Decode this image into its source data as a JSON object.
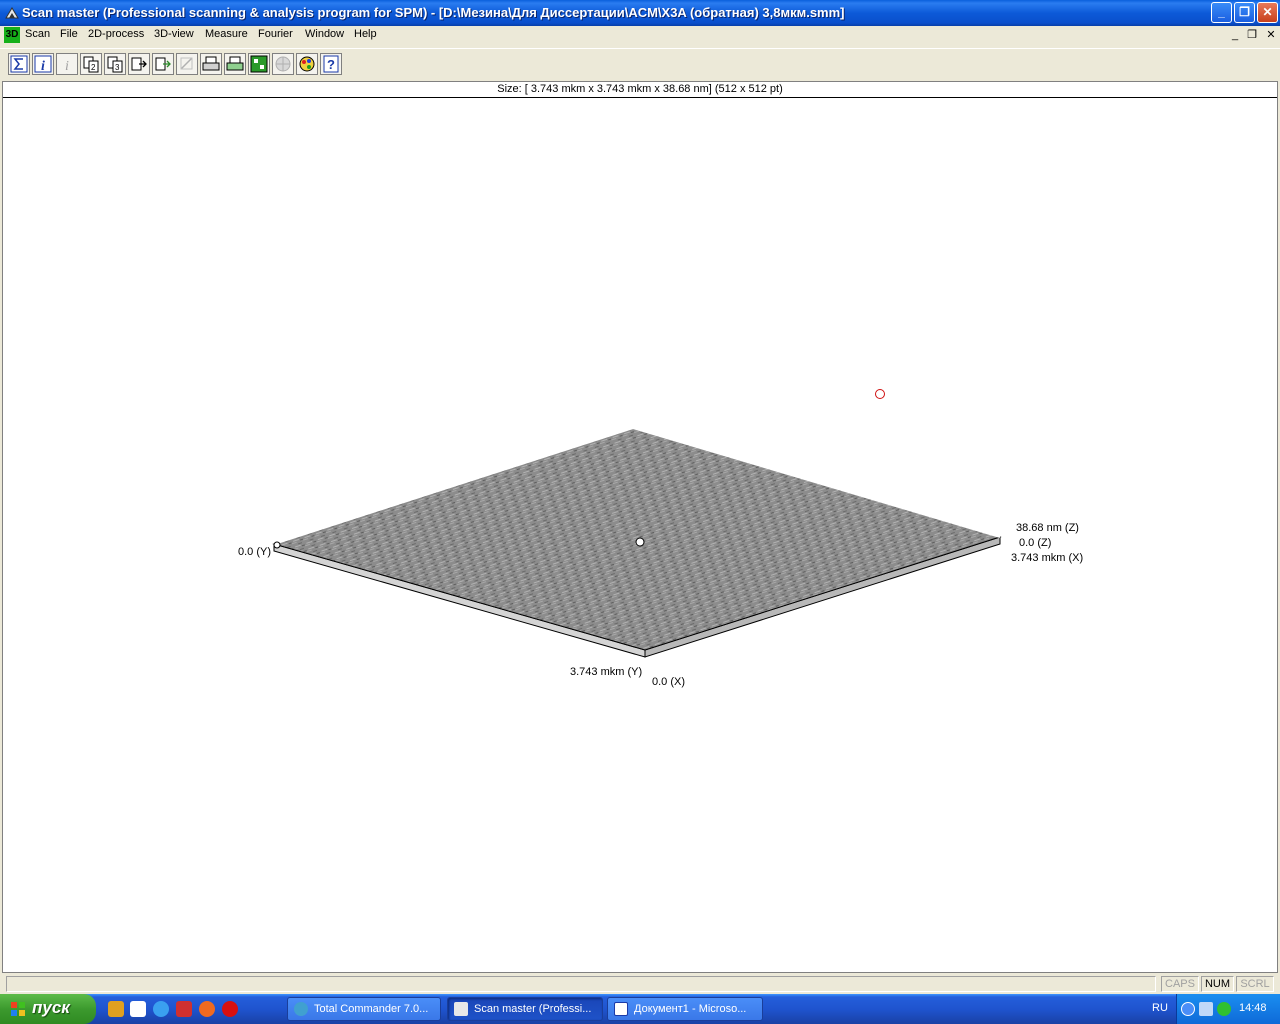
{
  "window": {
    "title": "Scan master (Professional scanning & analysis program for SPM) - [D:\\Мезина\\Для Диссертации\\ACM\\X3A (обратная) 3,8мкм.smm]",
    "minimize_label": "_",
    "maximize_label": "❐",
    "close_label": "✕"
  },
  "menu": {
    "doc_icon_text": "3D",
    "items": [
      "Scan",
      "File",
      "2D-process",
      "3D-view",
      "Measure",
      "Fourier",
      "Window",
      "Help"
    ],
    "mdi_minimize": "_",
    "mdi_restore": "❐",
    "mdi_close": "✕"
  },
  "toolbar": {
    "tools": [
      "sigma-icon",
      "info-icon",
      "info-disabled-icon",
      "copy-2-icon",
      "copy-3-icon",
      "export-1-icon",
      "export-2-icon",
      "disabled-tool-icon",
      "print-icon",
      "print-setup-icon",
      "stats-icon",
      "disabled-globe-icon",
      "palette-icon",
      "help-icon"
    ]
  },
  "document": {
    "size_info": "Size: [ 3.743 mkm x  3.743 mkm x  38.68 nm] (512 x 512 pt)",
    "axis_labels": {
      "y_origin": "0.0 (Y)",
      "y_max": "3.743 mkm (Y)",
      "x_origin": "0.0 (X)",
      "z_max": "38.68 nm (Z)",
      "z_origin": "0.0 (Z)",
      "x_max": "3.743 mkm (X)"
    }
  },
  "statusbar": {
    "caps": "CAPS",
    "num": "NUM",
    "scrl": "SCRL"
  },
  "taskbar": {
    "start_label": "пуск",
    "tasks": [
      "Total Commander 7.0...",
      "Scan master (Professi...",
      "Документ1 - Microso..."
    ],
    "language": "RU",
    "clock": "14:48"
  },
  "colors": {
    "title_blue": "#0a5fdc",
    "start_green": "#3c9a2e",
    "surface_gray": "#8a8a8a",
    "cursor_red": "#d01010"
  }
}
